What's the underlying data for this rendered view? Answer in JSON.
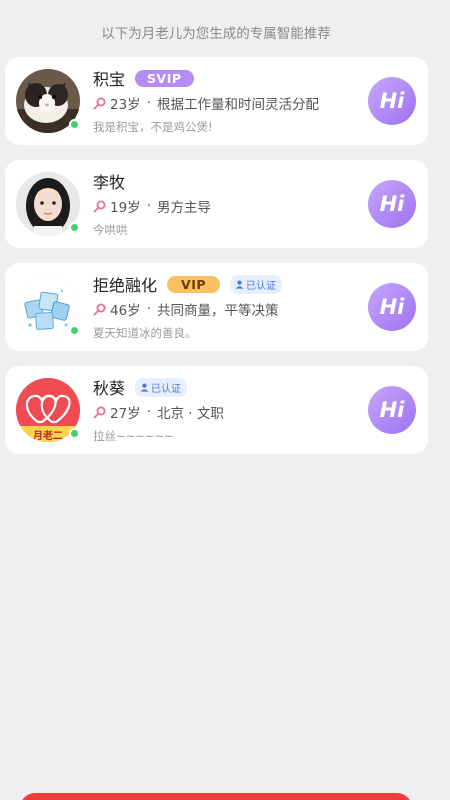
{
  "notice": "以下为月老儿为您生成的专属智能推荐",
  "cards": [
    {
      "name": "积宝",
      "badge": "SVIP",
      "age": "23岁",
      "desc": "根据工作量和时间灵活分配",
      "bio": "我是积宝，不是鸡公煲!",
      "hi": "Hi",
      "avatar_icon": "cat-photo"
    },
    {
      "name": "李牧",
      "age": "19岁",
      "desc": "男方主导",
      "bio": "今哄哄",
      "hi": "Hi",
      "avatar_icon": "girl-photo"
    },
    {
      "name": "拒绝融化",
      "badge": "VIP",
      "verified": "已认证",
      "age": "46岁",
      "desc": "共同商量，平等决策",
      "bio": "夏天知道冰的善良。",
      "hi": "Hi",
      "avatar_icon": "ice-cubes-photo"
    },
    {
      "name": "秋葵",
      "verified": "已认证",
      "age": "27岁",
      "desc": "北京 · 文职",
      "bio": "拉丝~~~~~~",
      "hi": "Hi",
      "avatar_icon": "yuelao-hearts-logo",
      "avatar_text": "月老二"
    }
  ],
  "colors": {
    "hi_button": "#a982f5",
    "svip": "#b58cf4",
    "vip": "#f9bf61",
    "online": "#3ed46a",
    "bottom_button": "#f33b3b"
  }
}
